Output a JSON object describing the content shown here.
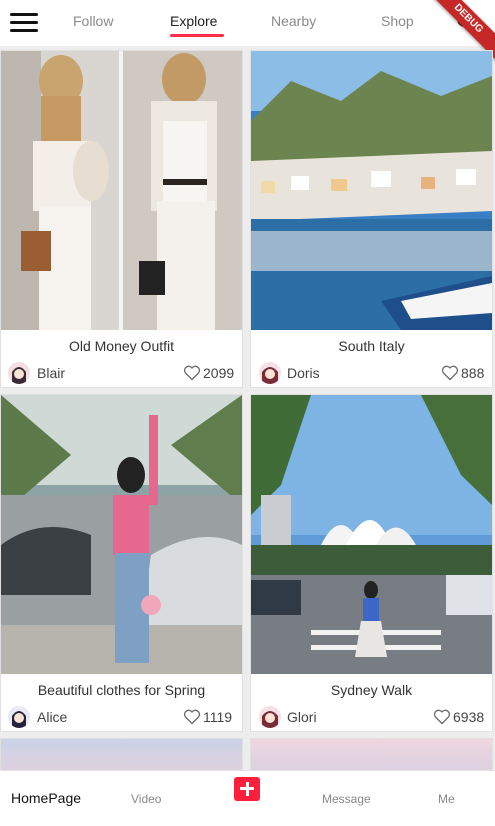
{
  "top_nav": {
    "tabs": [
      {
        "label": "Follow"
      },
      {
        "label": "Explore"
      },
      {
        "label": "Nearby"
      },
      {
        "label": "Shop"
      }
    ],
    "active_tab": "Explore",
    "debug_banner": "DEBUG"
  },
  "feed": {
    "cards": [
      {
        "title": "Old Money Outfit",
        "author": "Blair",
        "likes": "2099"
      },
      {
        "title": "South Italy",
        "author": "Doris",
        "likes": "888"
      },
      {
        "title": "Beautiful clothes for Spring",
        "author": "Alice",
        "likes": "1119"
      },
      {
        "title": "Sydney Walk",
        "author": "Glori",
        "likes": "6938"
      }
    ]
  },
  "bottom_nav": {
    "home": "HomePage",
    "video": "Video",
    "message": "Message",
    "me": "Me"
  },
  "colors": {
    "accent": "#ff2d4a",
    "active_text": "#222222",
    "inactive_text": "#8a8a8a"
  }
}
